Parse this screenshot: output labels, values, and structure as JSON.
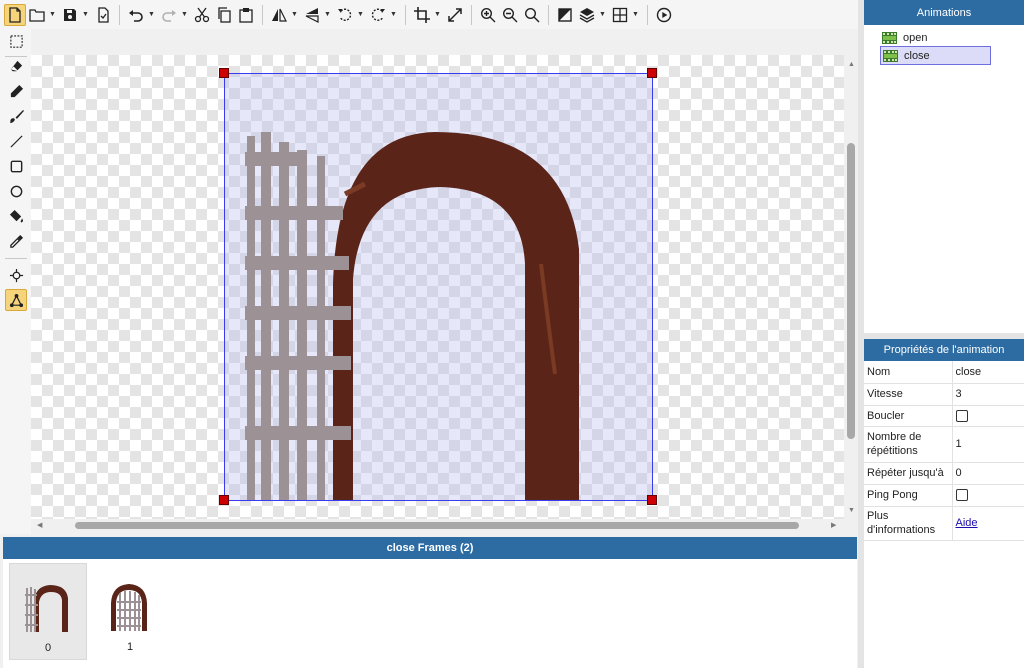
{
  "toolbar": {
    "buttons": [
      "new-file",
      "open",
      "save",
      "export",
      "undo",
      "redo",
      "cut",
      "copy",
      "paste",
      "flip-horizontal",
      "flip-vertical",
      "rotate-left",
      "rotate-right",
      "crop",
      "resize",
      "zoom-in",
      "zoom-out",
      "zoom-reset",
      "mask",
      "layers",
      "grid",
      "play"
    ]
  },
  "tools": [
    "marquee-select",
    "eraser",
    "pencil",
    "brush",
    "line",
    "rectangle",
    "ellipse",
    "paint-bucket",
    "eyedropper",
    "point",
    "polygon-vertices"
  ],
  "colors": {
    "accent": "#2d6ca2",
    "selection": "#3a3af0",
    "handle": "#cc0000",
    "door": "#5a2518",
    "grille": "#9c9296"
  },
  "frames": {
    "title": "close Frames (2)",
    "items": [
      {
        "label": "0"
      },
      {
        "label": "1"
      }
    ]
  },
  "animations": {
    "title": "Animations",
    "items": [
      {
        "label": "open"
      },
      {
        "label": "close"
      }
    ],
    "selected": "close"
  },
  "properties": {
    "title": "Propriétés de l'animation",
    "rows": {
      "name": {
        "key": "Nom",
        "value": "close"
      },
      "speed": {
        "key": "Vitesse",
        "value": "3"
      },
      "loop": {
        "key": "Boucler"
      },
      "repeat_count": {
        "key": "Nombre de répétitions",
        "value": "1"
      },
      "repeat_until": {
        "key": "Répéter jusqu'à",
        "value": "0"
      },
      "ping_pong": {
        "key": "Ping Pong"
      },
      "more_info": {
        "key": "Plus d'informations",
        "value": "Aide"
      }
    }
  }
}
